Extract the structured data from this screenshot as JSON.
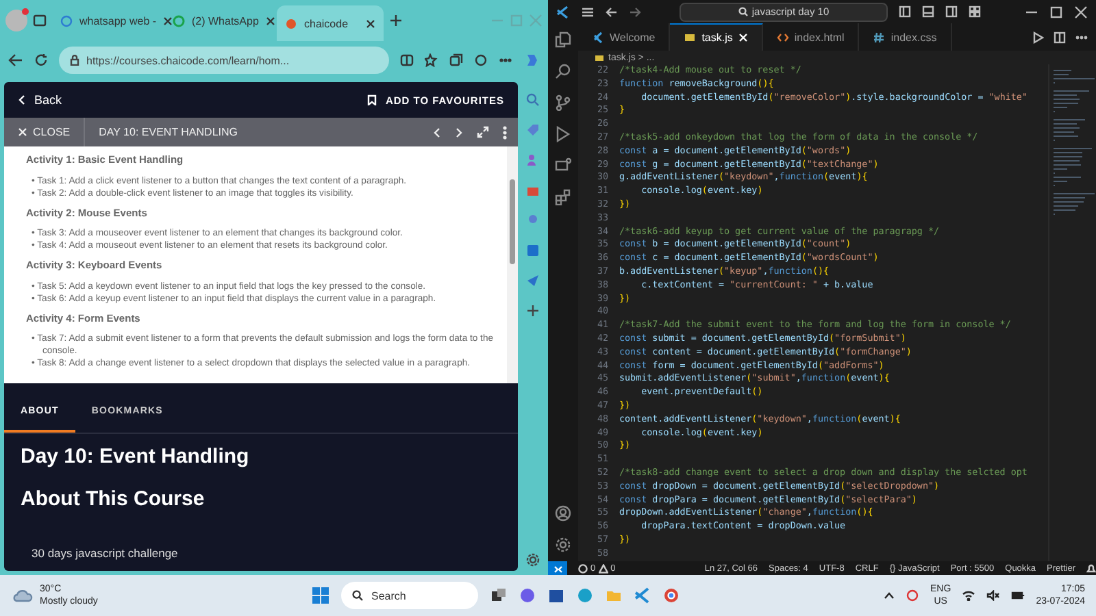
{
  "browser": {
    "tabs": [
      {
        "title": "whatsapp web -",
        "kind": "web",
        "selected": false
      },
      {
        "title": "(2) WhatsApp",
        "kind": "chat",
        "selected": false
      },
      {
        "title": "chaicode",
        "kind": "site",
        "selected": true
      }
    ],
    "url": "https://courses.chaicode.com/learn/hom...",
    "page": {
      "back": "Back",
      "favourite": "ADD TO FAVOURITES",
      "close": "CLOSE",
      "lesson_title": "DAY 10: EVENT HANDLING",
      "activities": [
        {
          "title": "Activity 1: Basic Event Handling",
          "tasks": [
            "• Task 1: Add a click event listener to a button that changes the text content of a paragraph.",
            "• Task 2: Add a double-click event listener to an image that toggles its visibility."
          ]
        },
        {
          "title": "Activity 2: Mouse Events",
          "tasks": [
            "• Task 3: Add a mouseover event listener to an element that changes its background color.",
            "• Task 4: Add a mouseout event listener to an element that resets its background color."
          ]
        },
        {
          "title": "Activity 3: Keyboard Events",
          "tasks": [
            "• Task 5: Add a keydown event listener to an input field that logs the key pressed to the console.",
            "• Task 6: Add a keyup event listener to an input field that displays the current value in a paragraph."
          ]
        },
        {
          "title": "Activity 4: Form Events",
          "tasks": [
            "• Task 7: Add a submit event listener to a form that prevents the default submission and logs the form data to the console.",
            "• Task 8: Add a change event listener to a select dropdown that displays the selected value in a paragraph."
          ]
        }
      ],
      "tabs": [
        {
          "label": "ABOUT",
          "selected": true
        },
        {
          "label": "BOOKMARKS",
          "selected": false
        }
      ],
      "heading": "Day 10: Event Handling",
      "subheading": "About This Course",
      "description": "30 days javascript challenge"
    }
  },
  "vscode": {
    "search": "javascript day 10",
    "tabs": [
      {
        "label": "Welcome",
        "kind": "welcome",
        "selected": false
      },
      {
        "label": "task.js",
        "kind": "js",
        "selected": true
      },
      {
        "label": "index.html",
        "kind": "html",
        "selected": false
      },
      {
        "label": "index.css",
        "kind": "css",
        "selected": false
      }
    ],
    "breadcrumb": "task.js > ...",
    "lines": [
      {
        "number": "22",
        "kind": "comment",
        "text": "/*task4-Add mouse out to reset */"
      },
      {
        "number": "23",
        "kind": "code",
        "text": "function removeBackground(){"
      },
      {
        "number": "24",
        "kind": "code",
        "text": "    document.getElementById(\"removeColor\").style.backgroundColor = \"white\""
      },
      {
        "number": "25",
        "kind": "code",
        "text": "}"
      },
      {
        "number": "26",
        "kind": "blank"
      },
      {
        "number": "27",
        "kind": "comment",
        "text": "/*task5-add onkeydown that log the form of data in the console */"
      },
      {
        "number": "28",
        "kind": "code",
        "text": "const a = document.getElementById(\"words\")"
      },
      {
        "number": "29",
        "kind": "code",
        "text": "const g = document.getElementById(\"textChange\")"
      },
      {
        "number": "30",
        "kind": "code",
        "text": "g.addEventListener(\"keydown\",function(event){"
      },
      {
        "number": "31",
        "kind": "code",
        "text": "    console.log(event.key)"
      },
      {
        "number": "32",
        "kind": "code",
        "text": "})"
      },
      {
        "number": "33",
        "kind": "blank"
      },
      {
        "number": "34",
        "kind": "comment",
        "text": "/*task6-add keyup to get current value of the paragrapg */"
      },
      {
        "number": "35",
        "kind": "code",
        "text": "const b = document.getElementById(\"count\")"
      },
      {
        "number": "36",
        "kind": "code",
        "text": "const c = document.getElementById(\"wordsCount\")"
      },
      {
        "number": "37",
        "kind": "code",
        "text": "b.addEventListener(\"keyup\",function(){"
      },
      {
        "number": "38",
        "kind": "code",
        "text": "    c.textContent = \"currentCount: \" + b.value"
      },
      {
        "number": "39",
        "kind": "code",
        "text": "})"
      },
      {
        "number": "40",
        "kind": "blank"
      },
      {
        "number": "41",
        "kind": "comment",
        "text": "/*task7-Add the submit event to the form and log the form in console */"
      },
      {
        "number": "42",
        "kind": "code",
        "text": "const submit = document.getElementById(\"formSubmit\")"
      },
      {
        "number": "43",
        "kind": "code",
        "text": "const content = document.getElementById(\"formChange\")"
      },
      {
        "number": "44",
        "kind": "code",
        "text": "const form = document.getElementById(\"addForms\")"
      },
      {
        "number": "45",
        "kind": "code",
        "text": "submit.addEventListener(\"submit\",function(event){"
      },
      {
        "number": "46",
        "kind": "code",
        "text": "    event.preventDefault()"
      },
      {
        "number": "47",
        "kind": "code",
        "text": "})"
      },
      {
        "number": "48",
        "kind": "code",
        "text": "content.addEventListener(\"keydown\",function(event){"
      },
      {
        "number": "49",
        "kind": "code",
        "text": "    console.log(event.key)"
      },
      {
        "number": "50",
        "kind": "code",
        "text": "})"
      },
      {
        "number": "51",
        "kind": "blank"
      },
      {
        "number": "52",
        "kind": "comment",
        "text": "/*task8-add change event to select a drop down and display the selcted opt"
      },
      {
        "number": "53",
        "kind": "code",
        "text": "const dropDown = document.getElementById(\"selectDropdown\")"
      },
      {
        "number": "54",
        "kind": "code",
        "text": "const dropPara = document.getElementById(\"selectPara\")"
      },
      {
        "number": "55",
        "kind": "code",
        "text": "dropDown.addEventListener(\"change\",function(){"
      },
      {
        "number": "56",
        "kind": "code",
        "text": "    dropPara.textContent = dropDown.value"
      },
      {
        "number": "57",
        "kind": "code",
        "text": "})"
      },
      {
        "number": "58",
        "kind": "blank"
      }
    ],
    "status_bar": {
      "errors": "0",
      "warnings": "0",
      "items": [
        "Ln 27, Col 66",
        "Spaces: 4",
        "UTF-8",
        "CRLF",
        "{} JavaScript",
        "Port : 5500",
        "Quokka",
        "Prettier"
      ]
    }
  },
  "taskbar": {
    "temperature": "30°C",
    "weather": "Mostly cloudy",
    "search": "Search",
    "language": "ENG",
    "region": "US",
    "time": "17:05",
    "date": "23-07-2024"
  }
}
